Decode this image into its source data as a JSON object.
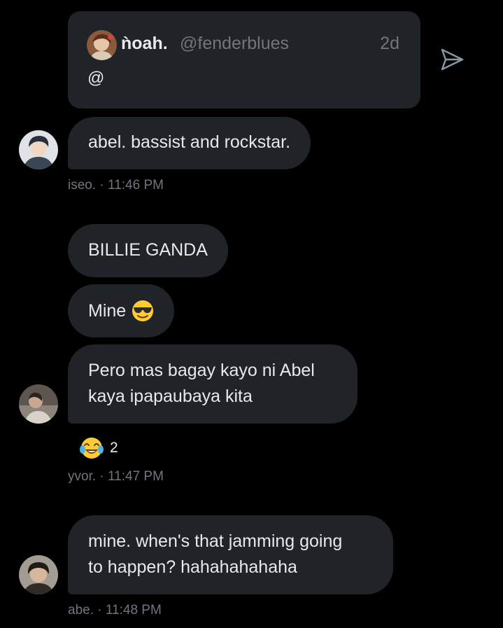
{
  "quoted_tweet": {
    "name": "ǹoah.",
    "handle": "@fenderblues",
    "time": "2d",
    "text": "@",
    "avatar_icon": "user-avatar-illustrated"
  },
  "send_icon": "send-icon",
  "messages": [
    {
      "text": "abel. bassist and rockstar."
    },
    {
      "text": "BILLIE GANDA"
    },
    {
      "text": "Mine",
      "emoji": "smiling-face-with-sunglasses"
    },
    {
      "text_line1": "Pero mas bagay kayo ni Abel",
      "text_line2": "kaya ipapaubaya kita"
    },
    {
      "text_line1": "mine. when's that jamming going",
      "text_line2": "to happen? hahahahahaha"
    }
  ],
  "meta": [
    {
      "sender": "iseo.",
      "sep": "·",
      "time": "11:46 PM"
    },
    {
      "sender": "yvor.",
      "sep": "·",
      "time": "11:47 PM"
    },
    {
      "sender": "abe.",
      "sep": "·",
      "time": "11:48 PM"
    }
  ],
  "reaction": {
    "emoji": "face-with-tears-of-joy",
    "count": "2"
  },
  "colors": {
    "background": "#000000",
    "bubble": "#202327",
    "text": "#e7e9ea",
    "muted": "#71767b"
  }
}
